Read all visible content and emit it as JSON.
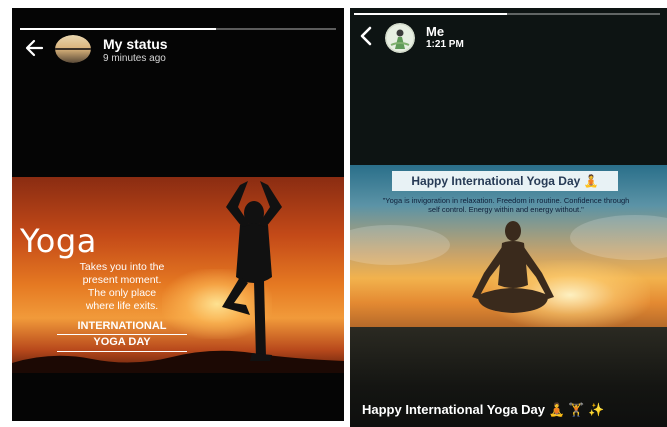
{
  "left_status": {
    "title": "My status",
    "time": "9 minutes ago",
    "progress": 0.62,
    "back_icon": "arrow-left-icon",
    "image": {
      "headline": "Yoga",
      "quote_lines": [
        "Takes you into the",
        "present moment.",
        "The only place",
        "where life exits."
      ],
      "footer_lines": [
        "INTERNATIONAL",
        "YOGA DAY"
      ]
    }
  },
  "right_status": {
    "title": "Me",
    "time": "1:21 PM",
    "progress": 0.5,
    "back_icon": "chevron-left-icon",
    "image": {
      "banner": "Happy International Yoga Day 🧘",
      "quote": "\"Yoga is invigoration in relaxation. Freedom in routine. Confidence through self control. Energy within and energy without.\""
    },
    "caption": "Happy International Yoga Day 🧘 🏋 ✨"
  }
}
